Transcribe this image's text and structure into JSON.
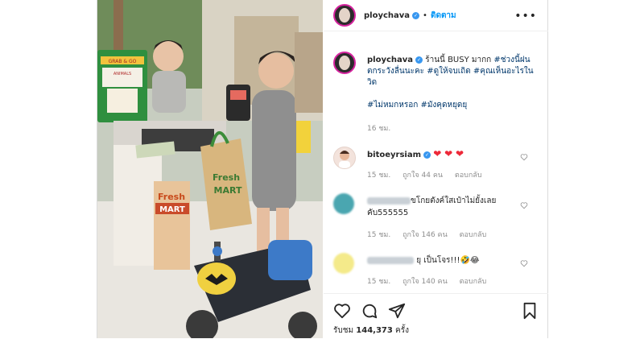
{
  "post": {
    "username": "ploychava",
    "follow_label": "ติดตาม",
    "more_label": "•••",
    "caption": {
      "username": "ploychava",
      "text_plain": " ร้านนี้ BUSY มากก ",
      "tag1": "#ช่วงนี้ฝนตกระวังลื่นนะคะ",
      "tag2": " #ดูให้จบเถิด",
      "tag3": " #คุณเห็นอะไรในวิด",
      "tags_line": "#ไม่หมกหรอก #มังคุดหยุดยุ",
      "time": "16 ชม."
    },
    "comments": [
      {
        "username": "bitoeyrsiam",
        "text": "",
        "hearts": "❤ ❤ ❤",
        "time": "15 ชม.",
        "likes": "ถูกใจ 44 คน",
        "reply": "ตอบกลับ"
      },
      {
        "username": "",
        "text": "ขโกยตังค์ใสเป๋าไม่ยั้งเลยคับ555555",
        "time": "15 ชม.",
        "likes": "ถูกใจ 146 คน",
        "reply": "ตอบกลับ"
      },
      {
        "username": "",
        "text": "ยุ เป็นโจร!!!🤣😂",
        "time": "15 ชม.",
        "likes": "ถูกใจ 140 คน",
        "reply": "ตอบกลับ"
      }
    ],
    "views_label": "รับชม",
    "views_count": "144,373",
    "views_unit": "ครั้ง",
    "photo_sign_1": "Fresh",
    "photo_sign_2": "MART",
    "photo_bag_1": "Fresh",
    "photo_bag_2": "MART",
    "photo_board": "GRAB & GO",
    "photo_animals": "ANIMALS"
  },
  "colors": {
    "accent": "#0095f6",
    "hashtag": "#00376b",
    "heart": "#ed2939",
    "muted": "#8e8e8e"
  },
  "icons": [
    "verified-icon",
    "more-icon",
    "heart-icon",
    "comment-icon",
    "share-icon",
    "bookmark-icon"
  ]
}
